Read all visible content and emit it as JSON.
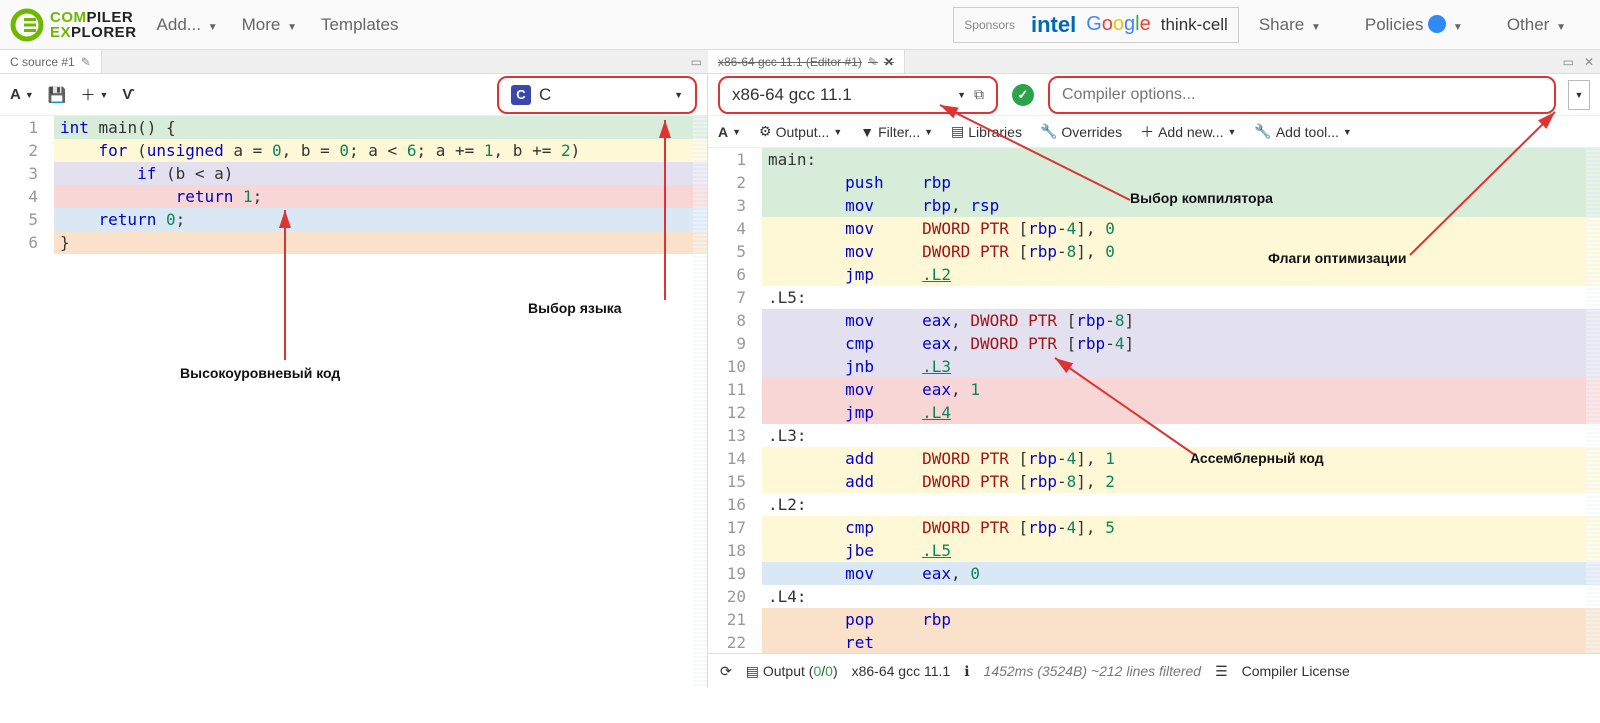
{
  "logo": {
    "line1_left": "COM",
    "line1_right": "PILER",
    "line2_left": "EX",
    "line2_right": "PLORER"
  },
  "nav": {
    "add": "Add...",
    "more": "More",
    "templates": "Templates"
  },
  "sponsors": {
    "label": "Sponsors",
    "intel": "intel",
    "google": "Google",
    "thinkcell": "think-cell"
  },
  "right_nav": {
    "share": "Share",
    "policies": "Policies",
    "other": "Other"
  },
  "left_tab": {
    "title": "C source #1"
  },
  "right_tab": {
    "title": "x86-64 gcc 11.1 (Editor #1)"
  },
  "toolbar_left": {
    "font_btn": "A",
    "vim": "Ѵ"
  },
  "lang": {
    "icon_letter": "C",
    "label": "C"
  },
  "compiler": {
    "label": "x86-64 gcc 11.1"
  },
  "options": {
    "placeholder": "Compiler options..."
  },
  "toolbar2": {
    "output": "Output...",
    "filter": "Filter...",
    "libraries": "Libraries",
    "overrides": "Overrides",
    "addnew": "Add new...",
    "addtool": "Add tool..."
  },
  "source_lines": [
    {
      "n": 1,
      "cls": "hl-green",
      "html": "<span class='k-blue'>int</span> main() {"
    },
    {
      "n": 2,
      "cls": "hl-yellow",
      "html": "    <span class='k-blue'>for</span> (<span class='k-blue'>unsigned</span> a = <span class='k-num'>0</span>, b = <span class='k-num'>0</span>; a &lt; <span class='k-num'>6</span>; a += <span class='k-num'>1</span>, b += <span class='k-num'>2</span>)"
    },
    {
      "n": 3,
      "cls": "hl-lav",
      "html": "        <span class='k-blue'>if</span> (b &lt; a)"
    },
    {
      "n": 4,
      "cls": "hl-pink",
      "html": "            <span class='k-blue'>return</span> <span class='k-num'>1</span>;"
    },
    {
      "n": 5,
      "cls": "hl-blue",
      "html": "    <span class='k-blue'>return</span> <span class='k-num'>0</span>;"
    },
    {
      "n": 6,
      "cls": "hl-orange",
      "html": "}"
    }
  ],
  "asm_lines": [
    {
      "n": 1,
      "cls": "hl-green",
      "html": "main:"
    },
    {
      "n": 2,
      "cls": "hl-green",
      "html": "        <span class='k-blue'>push</span>    <span class='k-reg'>rbp</span>"
    },
    {
      "n": 3,
      "cls": "hl-green",
      "html": "        <span class='k-blue'>mov</span>     <span class='k-reg'>rbp</span>, <span class='k-reg'>rsp</span>"
    },
    {
      "n": 4,
      "cls": "hl-yellow",
      "html": "        <span class='k-blue'>mov</span>     <span class='k-addr'>DWORD PTR</span> [<span class='k-reg'>rbp</span>-<span class='k-num'>4</span>], <span class='k-num'>0</span>"
    },
    {
      "n": 5,
      "cls": "hl-yellow",
      "html": "        <span class='k-blue'>mov</span>     <span class='k-addr'>DWORD PTR</span> [<span class='k-reg'>rbp</span>-<span class='k-num'>8</span>], <span class='k-num'>0</span>"
    },
    {
      "n": 6,
      "cls": "hl-yellow",
      "html": "        <span class='k-blue'>jmp</span>     <span class='k-link'>.L2</span>"
    },
    {
      "n": 7,
      "cls": "",
      "html": ".L5:"
    },
    {
      "n": 8,
      "cls": "hl-lav",
      "html": "        <span class='k-blue'>mov</span>     <span class='k-reg'>eax</span>, <span class='k-addr'>DWORD PTR</span> [<span class='k-reg'>rbp</span>-<span class='k-num'>8</span>]"
    },
    {
      "n": 9,
      "cls": "hl-lav",
      "html": "        <span class='k-blue'>cmp</span>     <span class='k-reg'>eax</span>, <span class='k-addr'>DWORD PTR</span> [<span class='k-reg'>rbp</span>-<span class='k-num'>4</span>]"
    },
    {
      "n": 10,
      "cls": "hl-lav",
      "html": "        <span class='k-blue'>jnb</span>     <span class='k-link'>.L3</span>"
    },
    {
      "n": 11,
      "cls": "hl-pink",
      "html": "        <span class='k-blue'>mov</span>     <span class='k-reg'>eax</span>, <span class='k-num'>1</span>"
    },
    {
      "n": 12,
      "cls": "hl-pink",
      "html": "        <span class='k-blue'>jmp</span>     <span class='k-link'>.L4</span>"
    },
    {
      "n": 13,
      "cls": "",
      "html": ".L3:"
    },
    {
      "n": 14,
      "cls": "hl-yellow",
      "html": "        <span class='k-blue'>add</span>     <span class='k-addr'>DWORD PTR</span> [<span class='k-reg'>rbp</span>-<span class='k-num'>4</span>], <span class='k-num'>1</span>"
    },
    {
      "n": 15,
      "cls": "hl-yellow",
      "html": "        <span class='k-blue'>add</span>     <span class='k-addr'>DWORD PTR</span> [<span class='k-reg'>rbp</span>-<span class='k-num'>8</span>], <span class='k-num'>2</span>"
    },
    {
      "n": 16,
      "cls": "",
      "html": ".L2:"
    },
    {
      "n": 17,
      "cls": "hl-yellow",
      "html": "        <span class='k-blue'>cmp</span>     <span class='k-addr'>DWORD PTR</span> [<span class='k-reg'>rbp</span>-<span class='k-num'>4</span>], <span class='k-num'>5</span>"
    },
    {
      "n": 18,
      "cls": "hl-yellow",
      "html": "        <span class='k-blue'>jbe</span>     <span class='k-link'>.L5</span>"
    },
    {
      "n": 19,
      "cls": "hl-blue",
      "html": "        <span class='k-blue'>mov</span>     <span class='k-reg'>eax</span>, <span class='k-num'>0</span>"
    },
    {
      "n": 20,
      "cls": "",
      "html": ".L4:"
    },
    {
      "n": 21,
      "cls": "hl-orange",
      "html": "        <span class='k-blue'>pop</span>     <span class='k-reg'>rbp</span>"
    },
    {
      "n": 22,
      "cls": "hl-orange",
      "html": "        <span class='k-blue'>ret</span>"
    }
  ],
  "bottom": {
    "output": "Output",
    "zeros": "0",
    "compiler": "x86-64 gcc 11.1",
    "timing": "1452ms (3524B) ~212 lines filtered",
    "license": "Compiler License"
  },
  "annotations": {
    "lang": "Выбор языка",
    "compiler": "Выбор компилятора",
    "flags": "Флаги оптимизации",
    "source": "Высокоуровневый код",
    "asm": "Ассемблерный код"
  }
}
